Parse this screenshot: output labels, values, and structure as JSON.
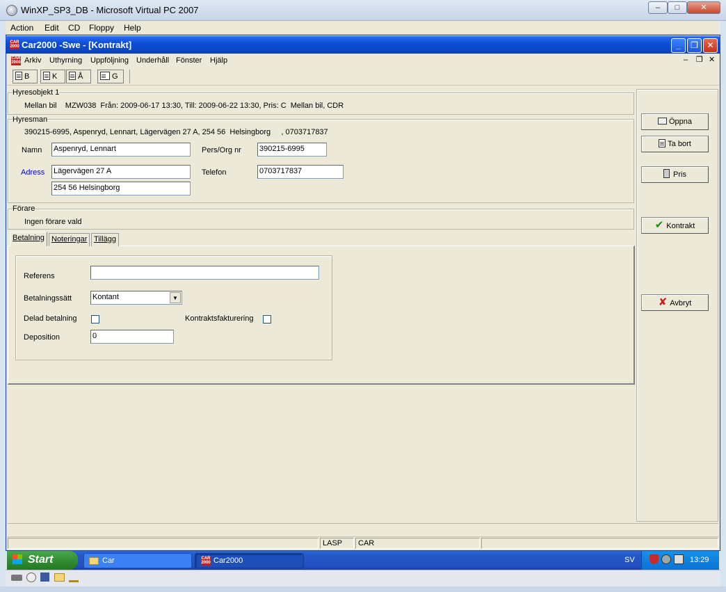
{
  "host_window": {
    "title": "WinXP_SP3_DB - Microsoft Virtual PC 2007",
    "menu": [
      "Action",
      "Edit",
      "CD",
      "Floppy",
      "Help"
    ]
  },
  "app_window": {
    "title": "Car2000 -Swe - [Kontrakt]",
    "menu": [
      "Arkiv",
      "Uthyrning",
      "Uppföljning",
      "Underhåll",
      "Fönster",
      "Hjälp"
    ],
    "toolbar": [
      "B",
      "K",
      "Å",
      "G"
    ]
  },
  "hyresobjekt": {
    "label": "Hyresobjekt 1",
    "summary": "Mellan bil    MZW038  Från: 2009-06-17 13:30, Till: 2009-06-22 13:30, Pris: C  Mellan bil, CDR"
  },
  "hyresman": {
    "label": "Hyresman",
    "summary": "390215-6995, Aspenryd, Lennart, Lägervägen 27 A, 254 56  Helsingborg     , 0703717837",
    "namn_label": "Namn",
    "namn_value": "Aspenryd, Lennart",
    "pers_label": "Pers/Org nr",
    "pers_value": "390215-6995",
    "adress_label": "Adress",
    "adress_line1": "Lägervägen 27 A",
    "adress_line2": "254 56  Helsingborg",
    "telefon_label": "Telefon",
    "telefon_value": "0703717837"
  },
  "forare": {
    "label": "Förare",
    "summary": "Ingen förare vald"
  },
  "tabs": [
    "Betalning",
    "Noteringar",
    "Tillägg"
  ],
  "betalning": {
    "referens_label": "Referens",
    "referens_value": "",
    "betalningssatt_label": "Betalningssätt",
    "betalningssatt_value": "Kontant",
    "delad_label": "Delad betalning",
    "kontraktsfakturering_label": "Kontraktsfakturering",
    "deposition_label": "Deposition",
    "deposition_value": "0"
  },
  "side_buttons": {
    "oppna": "Öppna",
    "ta_bort": "Ta bort",
    "pris": "Pris",
    "kontrakt": "Kontrakt",
    "avbryt": "Avbryt"
  },
  "statusbar": [
    "LASP",
    "CAR"
  ],
  "taskbar": {
    "start": "Start",
    "tasks": [
      "Car",
      "Car2000"
    ],
    "lang": "SV",
    "clock": "13:29"
  },
  "colors": {
    "xp_title_blue": "#0b4fd6",
    "window_face": "#ece9d8",
    "start_green": "#2f8a2f",
    "link_blue": "#0000cc",
    "taskbar_blue": "#2150c0"
  }
}
